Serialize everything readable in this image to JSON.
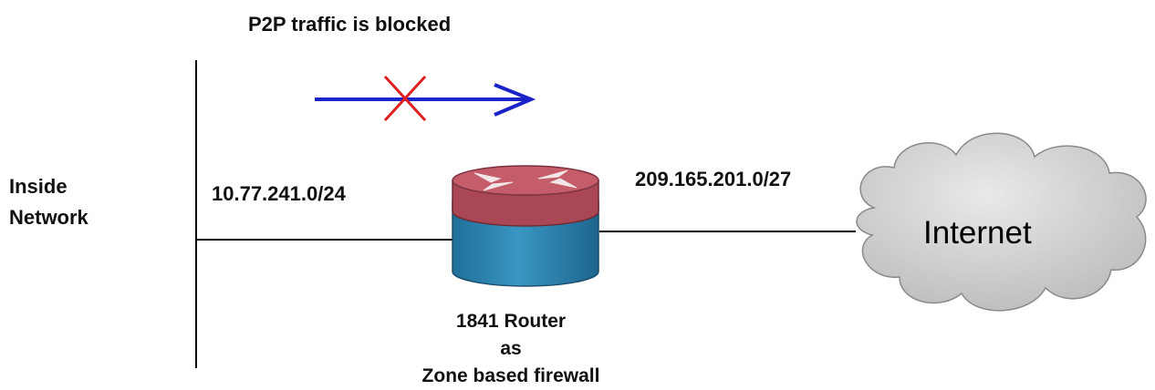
{
  "title": "P2P traffic is blocked",
  "inside_network": {
    "line1": "Inside",
    "line2": "Network"
  },
  "inside_subnet": "10.77.241.0/24",
  "outside_subnet": "209.165.201.0/27",
  "router": {
    "line1": "1841 Router",
    "line2": "as",
    "line3": "Zone based firewall"
  },
  "cloud_label": "Internet",
  "colors": {
    "traffic_arrow": "#1a23c8",
    "block_mark": "#e02020",
    "router_top": "#b9535f",
    "router_body": "#2f87b3",
    "cloud": "#c8c8c8",
    "line": "#000000"
  },
  "icons": [
    "router-icon",
    "cloud-icon",
    "traffic-arrow-icon",
    "blocked-x-icon"
  ]
}
